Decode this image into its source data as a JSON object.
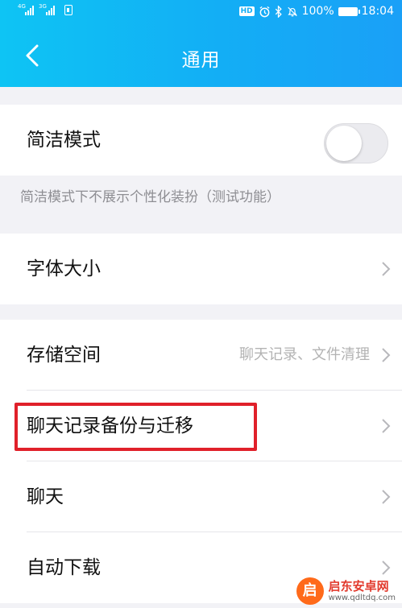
{
  "status_bar": {
    "signal1_label": "4G",
    "signal2_label": "3G",
    "battery_percent": "100%",
    "time": "18:04",
    "hd_badge": "HD",
    "icons": [
      "alarm-icon",
      "bluetooth-icon",
      "mute-icon",
      "battery-icon"
    ]
  },
  "nav": {
    "title": "通用",
    "back_icon": "chevron-left-icon"
  },
  "settings": {
    "simple_mode": {
      "label": "简洁模式",
      "toggle_on": false
    },
    "simple_mode_hint": "简洁模式下不展示个性化装扮（测试功能）",
    "font_size": {
      "label": "字体大小"
    },
    "storage": {
      "label": "存储空间",
      "detail": "聊天记录、文件清理"
    },
    "chat_backup": {
      "label": "聊天记录备份与迁移"
    },
    "chat": {
      "label": "聊天"
    },
    "auto_download": {
      "label": "自动下载"
    }
  },
  "watermark": {
    "name": "启东安卓网",
    "url": "www.qdltdq.com",
    "logo_glyph": "启"
  },
  "colors": {
    "header_start": "#0ec4f4",
    "header_end": "#1aa0f7",
    "highlight_border": "#e0202a",
    "page_bg": "#f2f2f6"
  }
}
